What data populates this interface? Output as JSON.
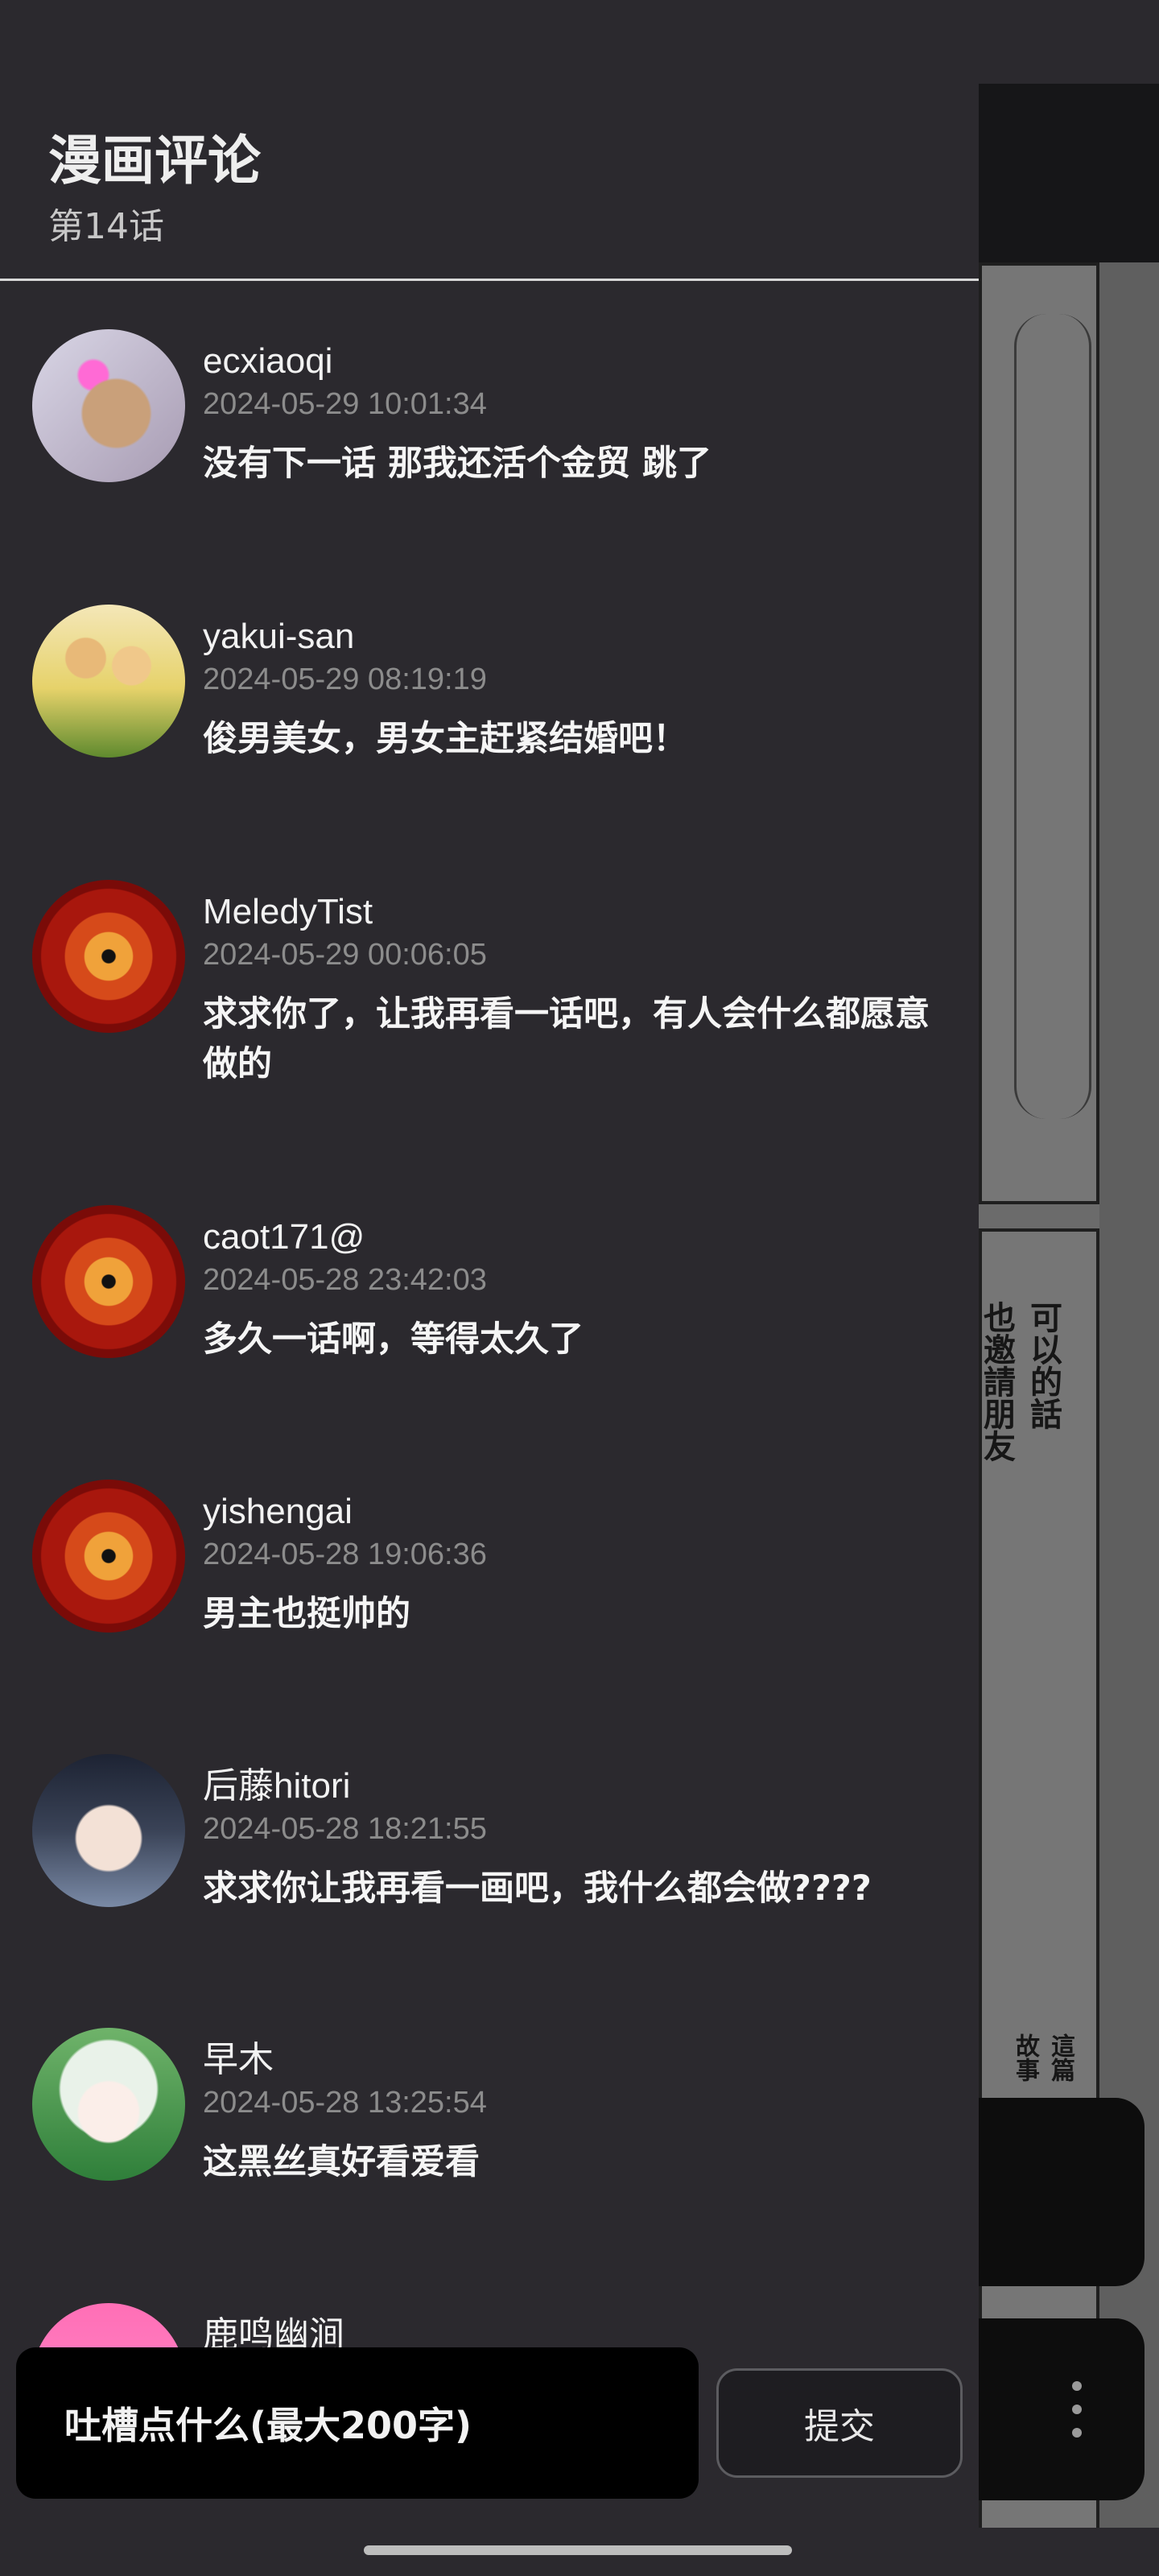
{
  "drawer": {
    "title": "漫画评论",
    "subtitle": "第14话"
  },
  "comments": [
    {
      "user": "ecxiaoqi",
      "time": "2024-05-29 10:01:34",
      "text": "没有下一话 那我还活个金贸 跳了",
      "avatar": "photo-avatar"
    },
    {
      "user": "yakui-san",
      "time": "2024-05-29 08:19:19",
      "text": "俊男美女，男女主赶紧结婚吧！",
      "avatar": "couple-avatar"
    },
    {
      "user": "MeledyTist",
      "time": "2024-05-29 00:06:05",
      "text": "求求你了，让我再看一话吧，有人会什么都愿意做的",
      "avatar": "sharingan-avatar"
    },
    {
      "user": "caot171@",
      "time": "2024-05-28 23:42:03",
      "text": "多久一话啊，等得太久了",
      "avatar": "sharingan-avatar"
    },
    {
      "user": "yishengai",
      "time": "2024-05-28 19:06:36",
      "text": "男主也挺帅的",
      "avatar": "sharingan-avatar"
    },
    {
      "user": "后藤hitori",
      "time": "2024-05-28 18:21:55",
      "text": "求求你让我再看一画吧，我什么都会做????",
      "avatar": "anime-avatar"
    },
    {
      "user": "早木",
      "time": "2024-05-28 13:25:54",
      "text": "这黑丝真好看爱看",
      "avatar": "anime-avatar"
    },
    {
      "user": "鹿鸣幽涧",
      "time": "",
      "text": "",
      "avatar": "pink-avatar"
    }
  ],
  "input": {
    "placeholder": "吐槽点什么(最大200字)"
  },
  "submit": {
    "label": "提交"
  },
  "manga": {
    "bubble_text_1": "可以的話",
    "bubble_text_2": "也邀請朋友",
    "caption_1": "這篇",
    "caption_2": "故事"
  },
  "icons": {
    "more": "more-vertical-icon"
  }
}
